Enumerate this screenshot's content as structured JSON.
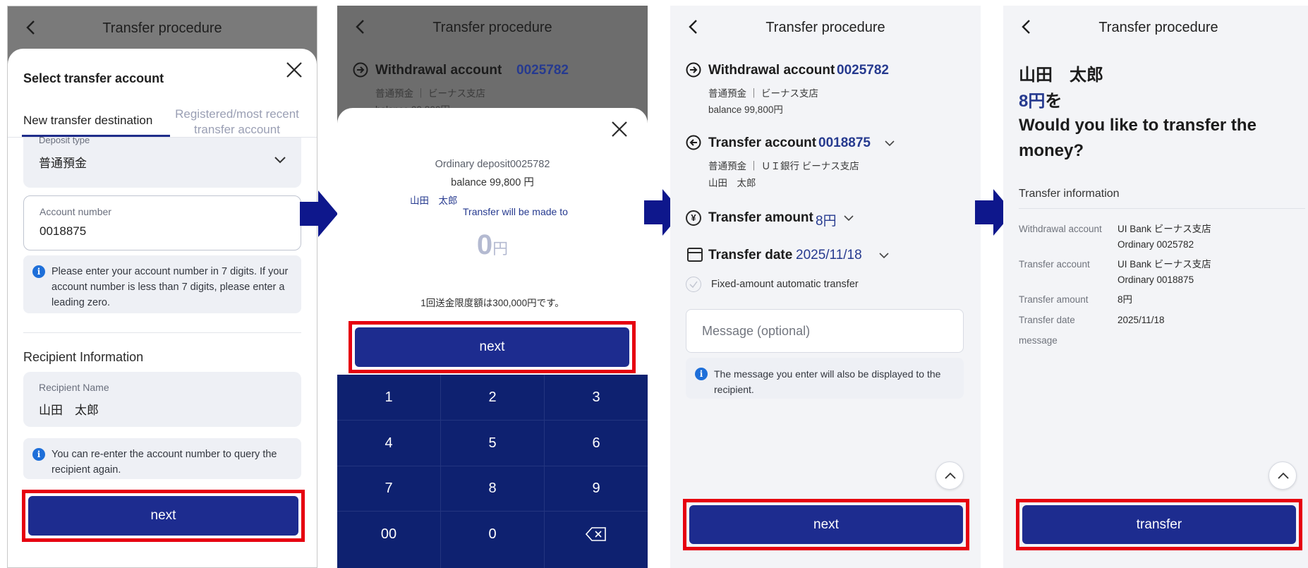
{
  "header_title": "Transfer procedure",
  "colors": {
    "accent": "#1d2c8f",
    "highlight": "#e6000f",
    "link_blue": "#263a8f",
    "keypad": "#0e2170",
    "flow_arrow": "#0e178c"
  },
  "screen1": {
    "sheet_title": "Select transfer account",
    "tab_new": "New transfer destination",
    "tab_registered": "Registered/most recent transfer account",
    "deposit_type_label": "Deposit type",
    "deposit_type_value": "普通預金",
    "account_number_label": "Account number",
    "account_number_value": "0018875",
    "account_hint": "Please enter your account number in 7 digits. If your account number is less than 7 digits, please enter a leading zero.",
    "recipient_section": "Recipient Information",
    "recipient_name_label": "Recipient Name",
    "recipient_name_value": "山田　太郎",
    "recipient_hint": "You can re-enter the account number to query the recipient again.",
    "next_label": "next"
  },
  "screen2": {
    "withdrawal_label": "Withdrawal account",
    "withdrawal_number": "0025782",
    "withdrawal_sub": "普通預金 ｜ ビーナス支店",
    "withdrawal_balance": "balance 99,800円",
    "deposit_line": "Ordinary deposit0025782",
    "balance_line": "balance 99,800 円",
    "recipient": "山田　太郎",
    "made_to": "Transfer will be made to",
    "amount": "0",
    "currency": "円",
    "limit_text": "1回送金限度額は300,000円です。",
    "next_label": "next",
    "keys": [
      "1",
      "2",
      "3",
      "4",
      "5",
      "6",
      "7",
      "8",
      "9",
      "00",
      "0"
    ]
  },
  "screen3": {
    "withdrawal_label": "Withdrawal account",
    "withdrawal_number": "0025782",
    "withdrawal_sub": "普通預金 ｜ ビーナス支店",
    "withdrawal_balance": "balance 99,800円",
    "transfer_label": "Transfer account",
    "transfer_number": "0018875",
    "transfer_sub": "普通預金 ｜ ＵＩ銀行 ビーナス支店",
    "transfer_name": "山田　太郎",
    "amount_label": "Transfer amount",
    "amount_value": "8円",
    "date_label": "Transfer date",
    "date_value": "2025/11/18",
    "fixed_label": "Fixed-amount automatic transfer",
    "message_placeholder": "Message (optional)",
    "message_hint": "The message you enter will also be displayed to the recipient.",
    "next_label": "next"
  },
  "screen4": {
    "name": "山田　太郎",
    "amount_line_value": "8円",
    "amount_line_suffix": "を",
    "question": "Would you like to transfer the money?",
    "info_title": "Transfer information",
    "rows": [
      {
        "key": "Withdrawal account",
        "value1": "UI Bank ビーナス支店",
        "value2": "Ordinary 0025782"
      },
      {
        "key": "Transfer account",
        "value1": "UI Bank ビーナス支店",
        "value2": "Ordinary 0018875"
      },
      {
        "key": "Transfer amount",
        "value1": "8円",
        "value2": ""
      },
      {
        "key": "Transfer date",
        "value1": "2025/11/18",
        "value2": ""
      },
      {
        "key": "message",
        "value1": "",
        "value2": ""
      }
    ],
    "transfer_label": "transfer"
  }
}
